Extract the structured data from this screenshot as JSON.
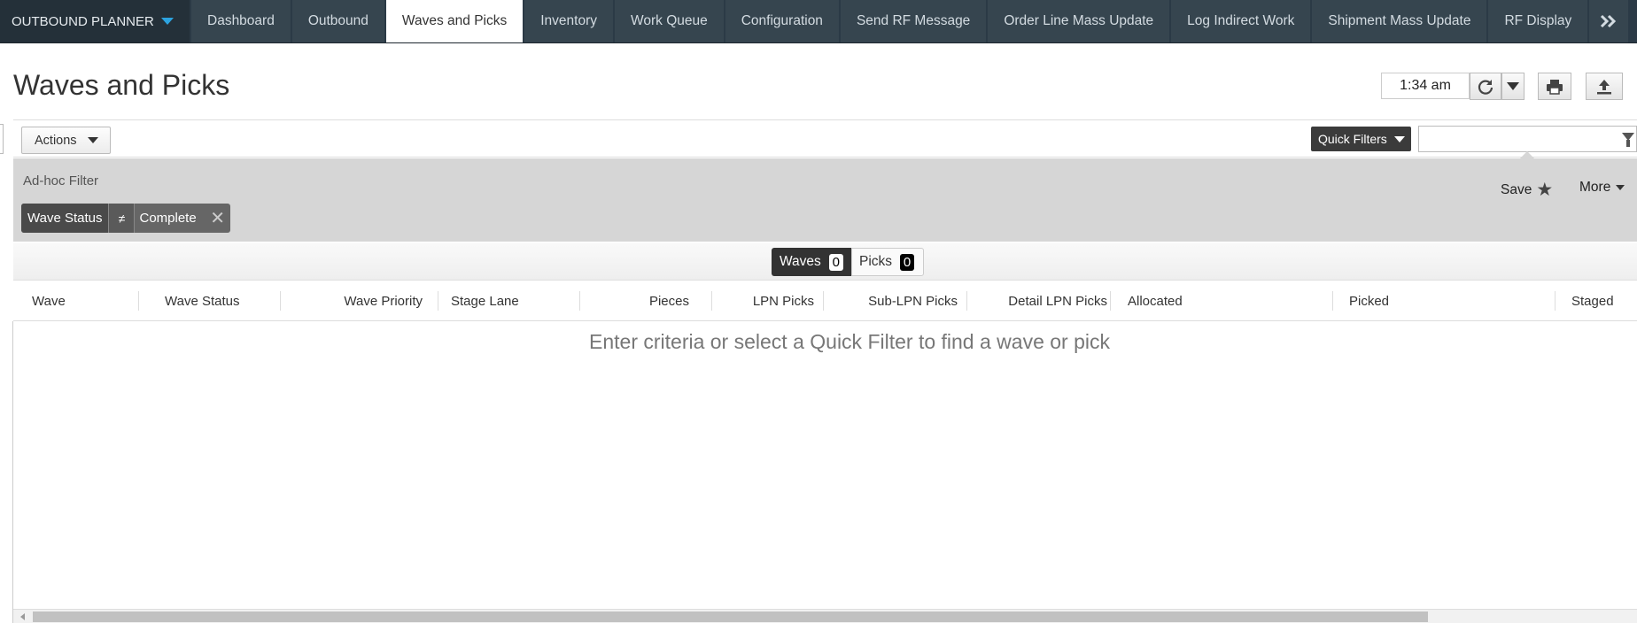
{
  "app": {
    "name": "OUTBOUND PLANNER"
  },
  "nav": {
    "tabs": [
      {
        "label": "Dashboard",
        "active": false
      },
      {
        "label": "Outbound",
        "active": false
      },
      {
        "label": "Waves and Picks",
        "active": true
      },
      {
        "label": "Inventory",
        "active": false
      },
      {
        "label": "Work Queue",
        "active": false
      },
      {
        "label": "Configuration",
        "active": false
      },
      {
        "label": "Send RF Message",
        "active": false
      },
      {
        "label": "Order Line Mass Update",
        "active": false
      },
      {
        "label": "Log Indirect Work",
        "active": false
      },
      {
        "label": "Shipment Mass Update",
        "active": false
      },
      {
        "label": "RF Display",
        "active": false
      }
    ],
    "more_icon": "double-chevron-right-icon"
  },
  "page": {
    "title": "Waves and Picks",
    "time": "1:34 am"
  },
  "header_icons": {
    "refresh": "refresh-icon",
    "print": "print-icon",
    "export": "upload-icon"
  },
  "toolbar": {
    "actions_label": "Actions",
    "quick_filters_label": "Quick Filters",
    "search_value": ""
  },
  "filter": {
    "label": "Ad-hoc Filter",
    "save_label": "Save",
    "more_label": "More",
    "chips": [
      {
        "field": "Wave Status",
        "operator": "≠",
        "value": "Complete"
      }
    ]
  },
  "toggle": {
    "waves_label": "Waves",
    "waves_count": "0",
    "picks_label": "Picks",
    "picks_count": "0",
    "selected": "Waves"
  },
  "grid": {
    "columns": [
      "Wave",
      "Wave Status",
      "Wave Priority",
      "Stage Lane",
      "Pieces",
      "LPN Picks",
      "Sub-LPN Picks",
      "Detail LPN Picks",
      "Allocated",
      "Picked",
      "Staged"
    ],
    "empty_message": "Enter criteria or select a Quick Filter to find a wave or pick"
  },
  "colors": {
    "nav_bg": "#2b3a46",
    "nav_tab_bg": "#36454f",
    "accent_caret": "#2ca3e0",
    "filter_panel_bg": "#d6d6d6",
    "chip_bg": "#666666"
  }
}
